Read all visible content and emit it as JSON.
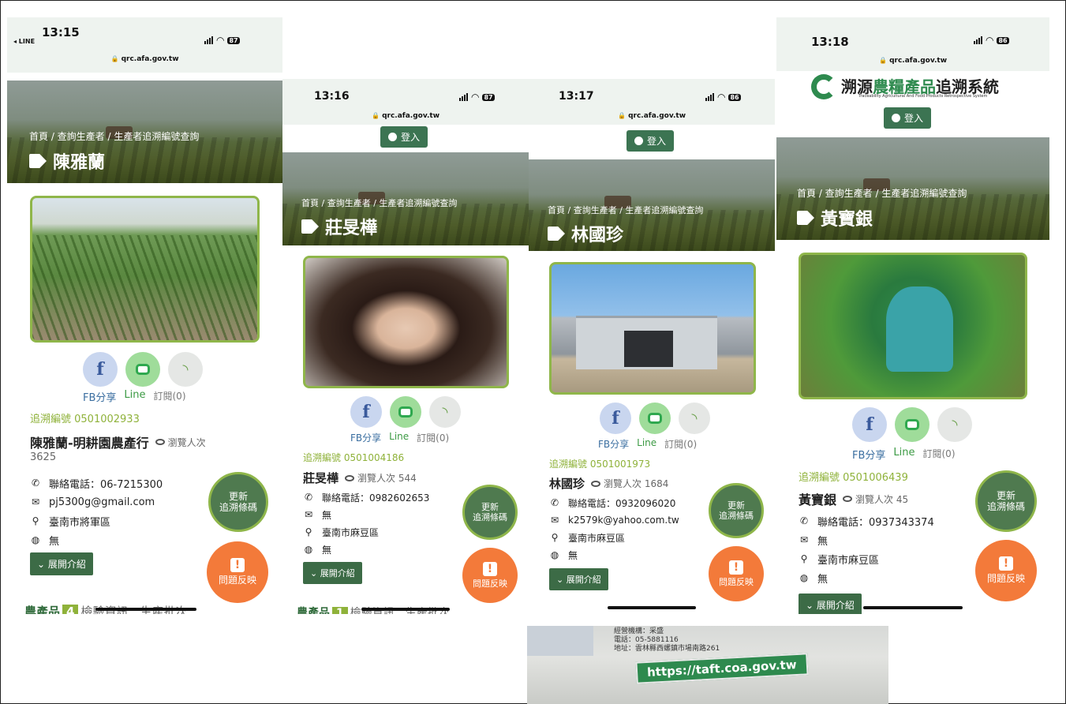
{
  "common": {
    "url": "qrc.afa.gov.tw",
    "breadcrumb": "首頁 / 查詢生產者 / 生產者追溯編號查詢",
    "login": "登入",
    "fb_label": "FB分享",
    "line_label": "Line",
    "subscribe_label": "訂閱(0)",
    "phone_prefix": "聯絡電話：",
    "expand_label": "展開介紹",
    "update_button": [
      "更新",
      "追溯條碼"
    ],
    "report_button": "問題反映",
    "report_badge": "!",
    "none": "無",
    "colors": {
      "accent_green": "#3c6b46",
      "trace_green": "#8fb23a",
      "report_orange": "#f37a3a",
      "border_green": "#8fb64a"
    }
  },
  "screens": [
    {
      "time": "13:15",
      "back_app": "◂ LINE",
      "battery": "87",
      "producer_name": "陳雅蘭",
      "trace_label": "追溯編號 0501002933",
      "farm_name": "陳雅蘭-明耕園農產行",
      "views_label": "瀏覽人次",
      "views_count": "3625",
      "phone": "06-7215300",
      "email": "pj5300g@gmail.com",
      "address": "臺南市將軍區",
      "website": "無",
      "bottom_text": "農產品",
      "bottom_badge": "4",
      "bottom_tail": "檢驗資訊　生產批次"
    },
    {
      "time": "13:16",
      "battery": "87",
      "producer_name": "莊旻樺",
      "trace_label": "追溯編號 0501004186",
      "farm_name": "莊旻樺",
      "views_label": "瀏覽人次 544",
      "phone": "0982602653",
      "email": "無",
      "address": "臺南市麻豆區",
      "website": "無",
      "bottom_text": "農產品",
      "bottom_badge": "1",
      "bottom_tail": "檢驗資訊　生產批次"
    },
    {
      "time": "13:17",
      "battery": "86",
      "producer_name": "林國珍",
      "trace_label": "追溯編號 0501001973",
      "farm_name": "林國珍",
      "views_label": "瀏覽人次 1684",
      "phone": "0932096020",
      "email": "k2579k@yahoo.com.tw",
      "address": "臺南市麻豆區",
      "website": "無"
    },
    {
      "time": "13:18",
      "battery": "86",
      "logo_title_a": "溯源",
      "logo_title_b": "農糧產品",
      "logo_title_c": "追溯系統",
      "logo_subtitle": "Traceability Agricultural And Food Products Retrospective System",
      "producer_name": "黃寶銀",
      "trace_label": "追溯編號 0501006439",
      "farm_name": "黃寶銀",
      "views_label": "瀏覽人次 45",
      "phone": "0937343374",
      "email": "無",
      "address": "臺南市麻豆區",
      "website": "無"
    }
  ],
  "bottom_photo": {
    "line1": "經營機構：采盛",
    "line2": "電話：05-5881116",
    "line3": "地址：雲林縣西螺鎮市場南路261",
    "url": "https://taft.coa.gov.tw"
  }
}
